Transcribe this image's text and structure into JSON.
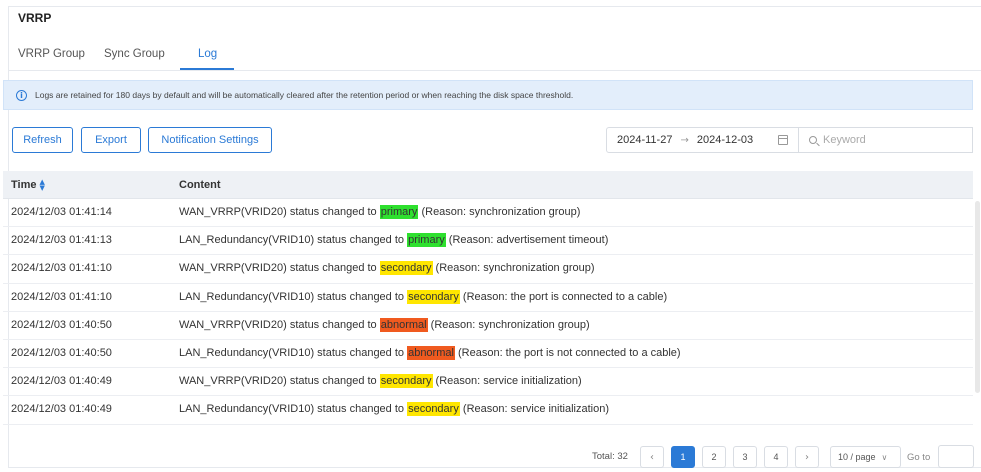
{
  "page": {
    "title": "VRRP"
  },
  "tabs": [
    {
      "label": "VRRP Group",
      "active": false
    },
    {
      "label": "Sync Group",
      "active": false
    },
    {
      "label": "Log",
      "active": true
    }
  ],
  "notice": {
    "icon": "info-icon",
    "text": "Logs are retained for 180 days by default and will be automatically cleared after the retention period or when reaching the disk space threshold."
  },
  "toolbar": {
    "refresh_label": "Refresh",
    "export_label": "Export",
    "notification_label": "Notification Settings",
    "date_start": "2024-11-27",
    "date_arrow": "→",
    "date_end": "2024-12-03",
    "search_placeholder": "Keyword"
  },
  "table": {
    "columns": [
      "Time",
      "Content"
    ],
    "rows": [
      {
        "time": "2024/12/03 01:41:14",
        "prefix": "WAN_VRRP(VRID20) status changed to ",
        "status": "primary",
        "status_color": "#2ee02e",
        "suffix": " (Reason: synchronization group)"
      },
      {
        "time": "2024/12/03 01:41:13",
        "prefix": "LAN_Redundancy(VRID10) status changed to ",
        "status": "primary",
        "status_color": "#2ee02e",
        "suffix": " (Reason: advertisement timeout)"
      },
      {
        "time": "2024/12/03 01:41:10",
        "prefix": "WAN_VRRP(VRID20) status changed to ",
        "status": "secondary",
        "status_color": "#ffe600",
        "suffix": " (Reason: synchronization group)"
      },
      {
        "time": "2024/12/03 01:41:10",
        "prefix": "LAN_Redundancy(VRID10) status changed to ",
        "status": "secondary",
        "status_color": "#ffe600",
        "suffix": " (Reason: the port is connected to a cable)"
      },
      {
        "time": "2024/12/03 01:40:50",
        "prefix": "WAN_VRRP(VRID20) status changed to ",
        "status": "abnormal",
        "status_color": "#f05a1f",
        "suffix": " (Reason: synchronization group)"
      },
      {
        "time": "2024/12/03 01:40:50",
        "prefix": "LAN_Redundancy(VRID10) status changed to ",
        "status": "abnormal",
        "status_color": "#f05a1f",
        "suffix": " (Reason: the port is not connected to a cable)"
      },
      {
        "time": "2024/12/03 01:40:49",
        "prefix": "WAN_VRRP(VRID20) status changed to ",
        "status": "secondary",
        "status_color": "#ffe600",
        "suffix": " (Reason: service initialization)"
      },
      {
        "time": "2024/12/03 01:40:49",
        "prefix": "LAN_Redundancy(VRID10) status changed to ",
        "status": "secondary",
        "status_color": "#ffe600",
        "suffix": " (Reason: service initialization)"
      }
    ]
  },
  "pagination": {
    "total_label": "Total: 32",
    "pages": [
      "1",
      "2",
      "3",
      "4"
    ],
    "current_page": "1",
    "page_size_label": "10 / page",
    "goto_label": "Go to"
  },
  "colors": {
    "accent": "#2b7ad6"
  }
}
